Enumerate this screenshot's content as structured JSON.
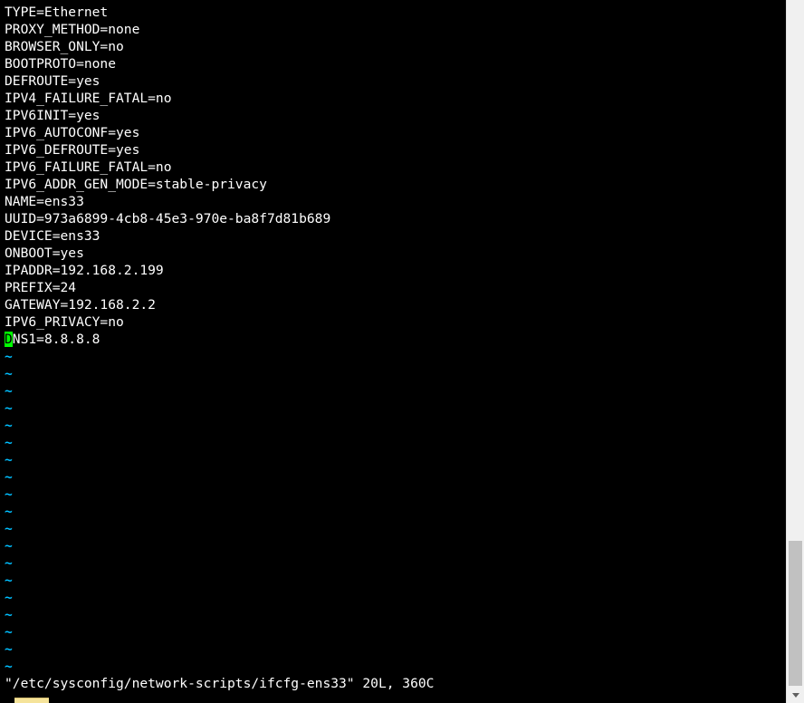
{
  "editor": {
    "lines": [
      "TYPE=Ethernet",
      "PROXY_METHOD=none",
      "BROWSER_ONLY=no",
      "BOOTPROTO=none",
      "DEFROUTE=yes",
      "IPV4_FAILURE_FATAL=no",
      "IPV6INIT=yes",
      "IPV6_AUTOCONF=yes",
      "IPV6_DEFROUTE=yes",
      "IPV6_FAILURE_FATAL=no",
      "IPV6_ADDR_GEN_MODE=stable-privacy",
      "NAME=ens33",
      "UUID=973a6899-4cb8-45e3-970e-ba8f7d81b689",
      "DEVICE=ens33",
      "ONBOOT=yes",
      "IPADDR=192.168.2.199",
      "PREFIX=24",
      "GATEWAY=192.168.2.2",
      "IPV6_PRIVACY=no"
    ],
    "cursor_line": {
      "cursor_char": "D",
      "rest": "NS1=8.8.8.8"
    },
    "empty_marker": "~",
    "empty_line_count": 19,
    "status_line": "\"/etc/sysconfig/network-scripts/ifcfg-ens33\" 20L, 360C"
  },
  "colors": {
    "background": "#000000",
    "text": "#ffffff",
    "tilde": "#00bfff",
    "cursor": "#00ff00",
    "scrollbar_track": "#f0f0f0",
    "scrollbar_thumb": "#c1c1c1"
  },
  "icons": {
    "scroll_down": "chevron-down-icon"
  },
  "scroll": {
    "visible_fraction": 0.21,
    "position": "bottom"
  }
}
